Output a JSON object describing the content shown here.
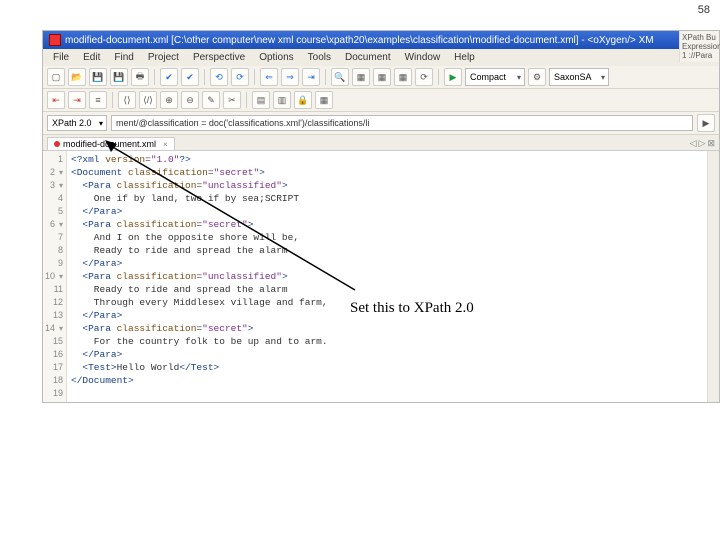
{
  "page_number": "58",
  "title": "modified-document.xml [C:\\other computer\\new xml course\\xpath20\\examples\\classification\\modified-document.xml] - <oXygen/> XM",
  "menu": [
    "File",
    "Edit",
    "Find",
    "Project",
    "Perspective",
    "Options",
    "Tools",
    "Document",
    "Window",
    "Help"
  ],
  "toolbar2": {
    "combo1": "Compact",
    "combo2": "SaxonSA"
  },
  "xpath": {
    "version": "XPath 2.0",
    "expr": "ment/@classification = doc('classifications.xml')/classifications/li"
  },
  "tab": {
    "name": "modified-document.xml"
  },
  "side": {
    "h1": "XPath Bu",
    "h2": "Expression",
    "r1": "1 ://Para"
  },
  "gutter": [
    "1",
    "2",
    "3",
    "4",
    "5",
    "6",
    "7",
    "8",
    "9",
    "10",
    "11",
    "12",
    "13",
    "14",
    "15",
    "16",
    "17",
    "18",
    "19"
  ],
  "code": {
    "l1a": "<?xml ",
    "l1b": "version",
    "l1c": "=",
    "l1d": "\"1.0\"",
    "l1e": "?>",
    "l2a": "<Document ",
    "l2b": "classification",
    "l2c": "=",
    "l2d": "\"secret\"",
    "l2e": ">",
    "l3a": "  <Para ",
    "l3b": "classification",
    "l3c": "=",
    "l3d": "\"unclassified\"",
    "l3e": ">",
    "l4": "    One if by land, two if by sea;SCRIPT",
    "l5": "  </Para>",
    "l6a": "  <Para ",
    "l6b": "classification",
    "l6c": "=",
    "l6d": "\"secret\"",
    "l6e": ">",
    "l7": "    And I on the opposite shore will be,",
    "l8": "    Ready to ride and spread the alarm",
    "l9": "  </Para>",
    "l10a": "  <Para ",
    "l10b": "classification",
    "l10c": "=",
    "l10d": "\"unclassified\"",
    "l10e": ">",
    "l11": "    Ready to ride and spread the alarm",
    "l12": "    Through every Middlesex village and farm,",
    "l13": "  </Para>",
    "l14a": "  <Para ",
    "l14b": "classification",
    "l14c": "=",
    "l14d": "\"secret\"",
    "l14e": ">",
    "l15": "    For the country folk to be up and to arm.",
    "l16": "  </Para>",
    "l17a": "  <Test>",
    "l17b": "Hello World",
    "l17c": "</Test>",
    "l18": "</Document>"
  },
  "annotation": "Set this to XPath 2.0"
}
